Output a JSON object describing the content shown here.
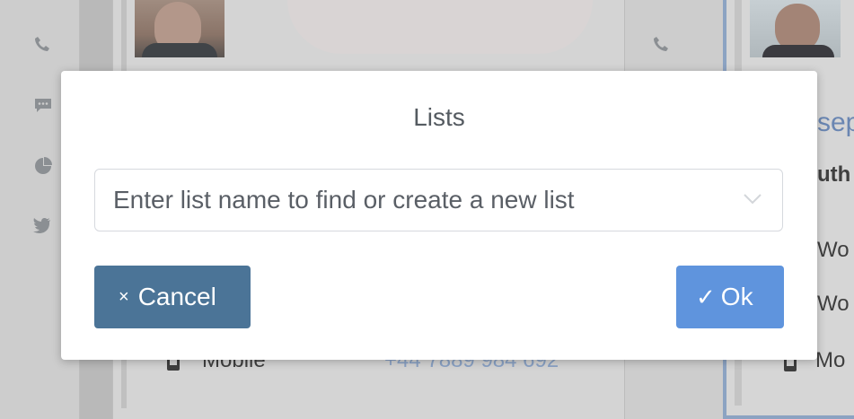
{
  "modal": {
    "title": "Lists",
    "search_placeholder": "Enter list name to find or create a new list",
    "cancel_label": "Cancel",
    "ok_label": "Ok",
    "cancel_icon": "×",
    "ok_icon": "✓"
  },
  "background": {
    "card1_row_label": "Mobile",
    "card1_row_value": "+44 7889 984 692",
    "card2_name_partial": "sep",
    "card2_subtitle_partial": "uth",
    "card2_row1_partial": "Wo",
    "card2_row2_partial": "Wo",
    "card2_row3_partial": "Mo"
  },
  "colors": {
    "cancel_button": "#4b7497",
    "ok_button": "#5f94dd",
    "backdrop": "#b9b9b9",
    "modal_bg": "#ffffff"
  },
  "icons": {
    "sidebar": [
      "phone-icon",
      "chat-icon",
      "pie-chart-icon",
      "twitter-icon"
    ],
    "dropdown": "chevron-down-icon"
  }
}
